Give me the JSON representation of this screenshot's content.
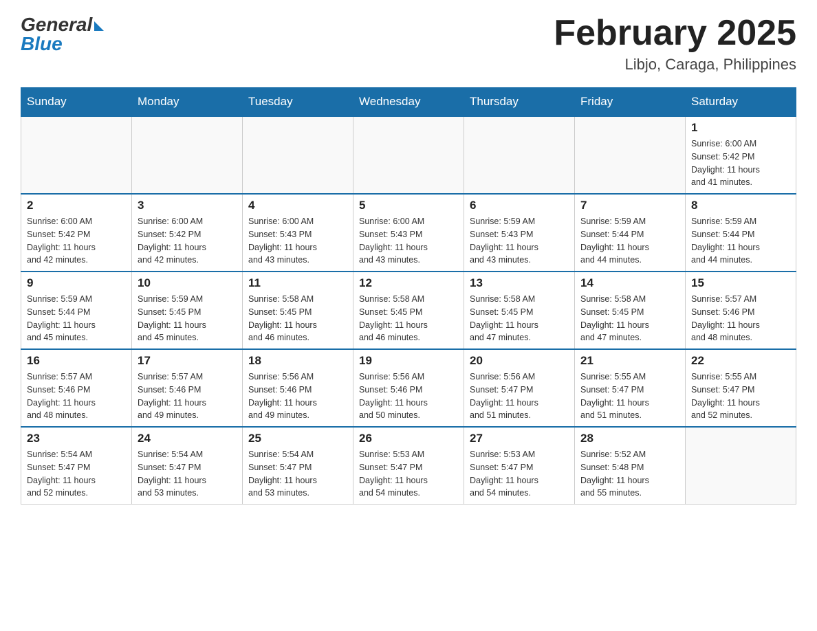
{
  "header": {
    "logo_general": "General",
    "logo_blue": "Blue",
    "month_title": "February 2025",
    "location": "Libjo, Caraga, Philippines"
  },
  "weekdays": [
    "Sunday",
    "Monday",
    "Tuesday",
    "Wednesday",
    "Thursday",
    "Friday",
    "Saturday"
  ],
  "weeks": [
    [
      {
        "day": "",
        "info": ""
      },
      {
        "day": "",
        "info": ""
      },
      {
        "day": "",
        "info": ""
      },
      {
        "day": "",
        "info": ""
      },
      {
        "day": "",
        "info": ""
      },
      {
        "day": "",
        "info": ""
      },
      {
        "day": "1",
        "info": "Sunrise: 6:00 AM\nSunset: 5:42 PM\nDaylight: 11 hours\nand 41 minutes."
      }
    ],
    [
      {
        "day": "2",
        "info": "Sunrise: 6:00 AM\nSunset: 5:42 PM\nDaylight: 11 hours\nand 42 minutes."
      },
      {
        "day": "3",
        "info": "Sunrise: 6:00 AM\nSunset: 5:42 PM\nDaylight: 11 hours\nand 42 minutes."
      },
      {
        "day": "4",
        "info": "Sunrise: 6:00 AM\nSunset: 5:43 PM\nDaylight: 11 hours\nand 43 minutes."
      },
      {
        "day": "5",
        "info": "Sunrise: 6:00 AM\nSunset: 5:43 PM\nDaylight: 11 hours\nand 43 minutes."
      },
      {
        "day": "6",
        "info": "Sunrise: 5:59 AM\nSunset: 5:43 PM\nDaylight: 11 hours\nand 43 minutes."
      },
      {
        "day": "7",
        "info": "Sunrise: 5:59 AM\nSunset: 5:44 PM\nDaylight: 11 hours\nand 44 minutes."
      },
      {
        "day": "8",
        "info": "Sunrise: 5:59 AM\nSunset: 5:44 PM\nDaylight: 11 hours\nand 44 minutes."
      }
    ],
    [
      {
        "day": "9",
        "info": "Sunrise: 5:59 AM\nSunset: 5:44 PM\nDaylight: 11 hours\nand 45 minutes."
      },
      {
        "day": "10",
        "info": "Sunrise: 5:59 AM\nSunset: 5:45 PM\nDaylight: 11 hours\nand 45 minutes."
      },
      {
        "day": "11",
        "info": "Sunrise: 5:58 AM\nSunset: 5:45 PM\nDaylight: 11 hours\nand 46 minutes."
      },
      {
        "day": "12",
        "info": "Sunrise: 5:58 AM\nSunset: 5:45 PM\nDaylight: 11 hours\nand 46 minutes."
      },
      {
        "day": "13",
        "info": "Sunrise: 5:58 AM\nSunset: 5:45 PM\nDaylight: 11 hours\nand 47 minutes."
      },
      {
        "day": "14",
        "info": "Sunrise: 5:58 AM\nSunset: 5:45 PM\nDaylight: 11 hours\nand 47 minutes."
      },
      {
        "day": "15",
        "info": "Sunrise: 5:57 AM\nSunset: 5:46 PM\nDaylight: 11 hours\nand 48 minutes."
      }
    ],
    [
      {
        "day": "16",
        "info": "Sunrise: 5:57 AM\nSunset: 5:46 PM\nDaylight: 11 hours\nand 48 minutes."
      },
      {
        "day": "17",
        "info": "Sunrise: 5:57 AM\nSunset: 5:46 PM\nDaylight: 11 hours\nand 49 minutes."
      },
      {
        "day": "18",
        "info": "Sunrise: 5:56 AM\nSunset: 5:46 PM\nDaylight: 11 hours\nand 49 minutes."
      },
      {
        "day": "19",
        "info": "Sunrise: 5:56 AM\nSunset: 5:46 PM\nDaylight: 11 hours\nand 50 minutes."
      },
      {
        "day": "20",
        "info": "Sunrise: 5:56 AM\nSunset: 5:47 PM\nDaylight: 11 hours\nand 51 minutes."
      },
      {
        "day": "21",
        "info": "Sunrise: 5:55 AM\nSunset: 5:47 PM\nDaylight: 11 hours\nand 51 minutes."
      },
      {
        "day": "22",
        "info": "Sunrise: 5:55 AM\nSunset: 5:47 PM\nDaylight: 11 hours\nand 52 minutes."
      }
    ],
    [
      {
        "day": "23",
        "info": "Sunrise: 5:54 AM\nSunset: 5:47 PM\nDaylight: 11 hours\nand 52 minutes."
      },
      {
        "day": "24",
        "info": "Sunrise: 5:54 AM\nSunset: 5:47 PM\nDaylight: 11 hours\nand 53 minutes."
      },
      {
        "day": "25",
        "info": "Sunrise: 5:54 AM\nSunset: 5:47 PM\nDaylight: 11 hours\nand 53 minutes."
      },
      {
        "day": "26",
        "info": "Sunrise: 5:53 AM\nSunset: 5:47 PM\nDaylight: 11 hours\nand 54 minutes."
      },
      {
        "day": "27",
        "info": "Sunrise: 5:53 AM\nSunset: 5:47 PM\nDaylight: 11 hours\nand 54 minutes."
      },
      {
        "day": "28",
        "info": "Sunrise: 5:52 AM\nSunset: 5:48 PM\nDaylight: 11 hours\nand 55 minutes."
      },
      {
        "day": "",
        "info": ""
      }
    ]
  ]
}
